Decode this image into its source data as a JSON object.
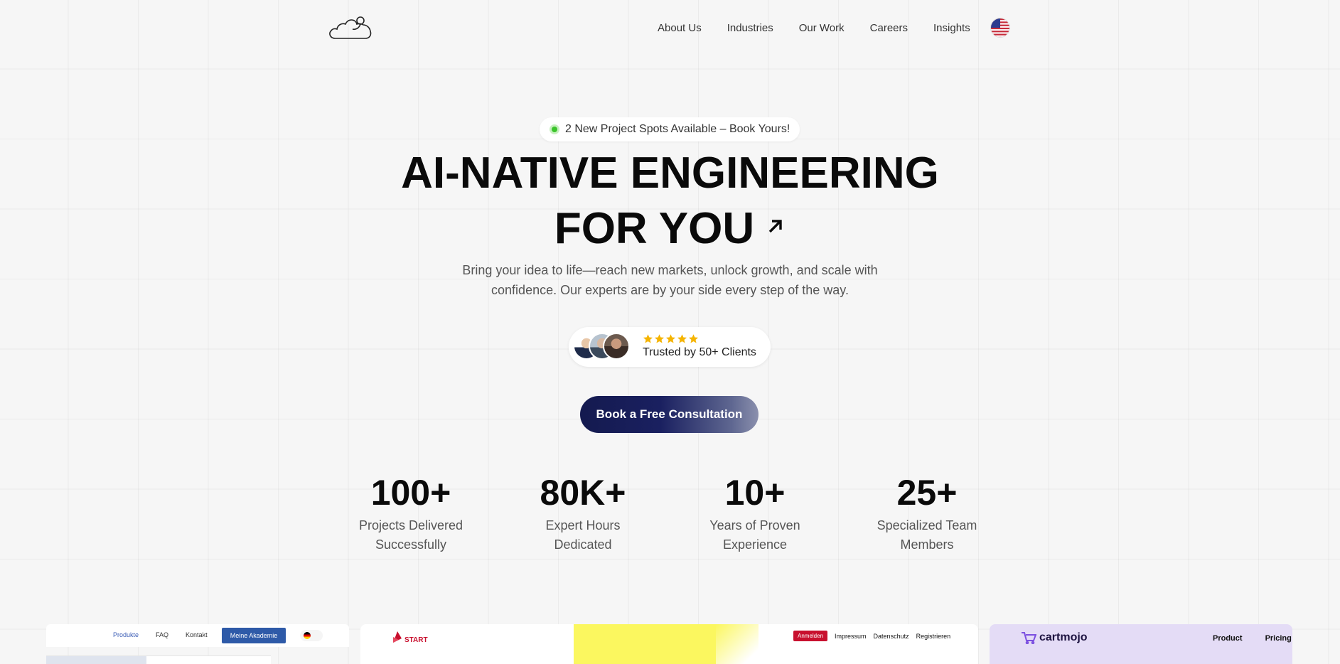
{
  "nav": {
    "items": [
      "About Us",
      "Industries",
      "Our Work",
      "Careers",
      "Insights"
    ],
    "language_flag": "us-flag-icon"
  },
  "hero": {
    "badge": "2 New Project Spots Available – Book Yours!",
    "title_line1": "AI-NATIVE ENGINEERING",
    "title_line2": "FOR YOU",
    "subtitle_line1": "Bring your idea to life—reach new markets, unlock growth, and scale with",
    "subtitle_line2": "confidence. Our experts are by your side every step of the way.",
    "rating_stars": 5,
    "trust_text": "Trusted by 50+ Clients",
    "cta": "Book a Free Consultation"
  },
  "stats": [
    {
      "value": "100+",
      "label_line1": "Projects Delivered",
      "label_line2": "Successfully"
    },
    {
      "value": "80K+",
      "label_line1": "Expert Hours",
      "label_line2": "Dedicated"
    },
    {
      "value": "10+",
      "label_line1": "Years of Proven",
      "label_line2": "Experience"
    },
    {
      "value": "25+",
      "label_line1": "Specialized Team",
      "label_line2": "Members"
    }
  ],
  "previews": {
    "p1": {
      "links": [
        "Produkte",
        "FAQ",
        "Kontakt"
      ],
      "button": "Meine Akademie"
    },
    "p2": {
      "brand": "START",
      "login": "Anmelden",
      "links": [
        "Impressum",
        "Datenschutz",
        "Registrieren"
      ]
    },
    "p3": {
      "brand": "cartmojo",
      "links": [
        "Product",
        "Pricing"
      ]
    }
  },
  "colors": {
    "accent": "#141a4f",
    "badge_dot": "#3bc42b",
    "star": "#f5b400",
    "background": "#f6f6f6"
  }
}
